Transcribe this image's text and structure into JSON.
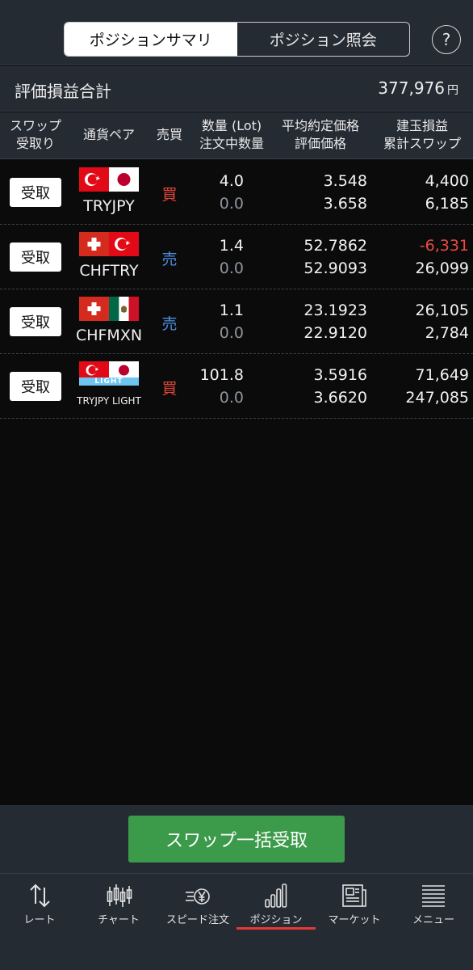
{
  "header": {
    "tabs": [
      {
        "label": "ポジションサマリ",
        "active": true
      },
      {
        "label": "ポジション照会",
        "active": false
      }
    ],
    "help_label": "?"
  },
  "summary": {
    "label": "評価損益合計",
    "value": "377,976",
    "unit": "円"
  },
  "table": {
    "headers": {
      "swap_receive": [
        "スワップ",
        "受取り"
      ],
      "pair": [
        "通貨ペア"
      ],
      "side": [
        "売買"
      ],
      "quantity": [
        "数量 (Lot)",
        "注文中数量"
      ],
      "price": [
        "平均約定価格",
        "評価価格"
      ],
      "pl": [
        "建玉損益",
        "累計スワップ"
      ]
    },
    "rows": [
      {
        "receive_label": "受取",
        "pair": "TRYJPY",
        "flags": [
          "TR",
          "JP"
        ],
        "side": "買",
        "side_type": "buy",
        "quantity": "4.0",
        "pending_quantity": "0.0",
        "avg_price": "3.548",
        "eval_price": "3.658",
        "pl": "4,400",
        "swap": "6,185",
        "pl_negative": false
      },
      {
        "receive_label": "受取",
        "pair": "CHFTRY",
        "flags": [
          "CH",
          "TR"
        ],
        "side": "売",
        "side_type": "sell",
        "quantity": "1.4",
        "pending_quantity": "0.0",
        "avg_price": "52.7862",
        "eval_price": "52.9093",
        "pl": "-6,331",
        "swap": "26,099",
        "pl_negative": true
      },
      {
        "receive_label": "受取",
        "pair": "CHFMXN",
        "flags": [
          "CH",
          "MX"
        ],
        "side": "売",
        "side_type": "sell",
        "quantity": "1.1",
        "pending_quantity": "0.0",
        "avg_price": "23.1923",
        "eval_price": "22.9120",
        "pl": "26,105",
        "swap": "2,784",
        "pl_negative": false
      },
      {
        "receive_label": "受取",
        "pair": "TRYJPY LIGHT",
        "flags": [
          "TR",
          "JP"
        ],
        "light_badge": "LIGHT",
        "side": "買",
        "side_type": "buy",
        "quantity": "101.8",
        "pending_quantity": "0.0",
        "avg_price": "3.5916",
        "eval_price": "3.6620",
        "pl": "71,649",
        "swap": "247,085",
        "pl_negative": false
      }
    ]
  },
  "bulk_button": "スワップ一括受取",
  "nav": {
    "items": [
      {
        "label": "レート",
        "icon": "rate-arrows-icon"
      },
      {
        "label": "チャート",
        "icon": "candlestick-icon"
      },
      {
        "label": "スピード注文",
        "icon": "yen-speed-icon"
      },
      {
        "label": "ポジション",
        "icon": "bar-chart-icon",
        "active": true
      },
      {
        "label": "マーケット",
        "icon": "newspaper-icon"
      },
      {
        "label": "メニュー",
        "icon": "menu-list-icon"
      }
    ]
  },
  "colors": {
    "buy": "#e5453a",
    "sell": "#4c8fe0",
    "negative": "#ea4b3e",
    "bulk_button": "#3c9b4b",
    "active_tab_underline": "#e53935"
  }
}
